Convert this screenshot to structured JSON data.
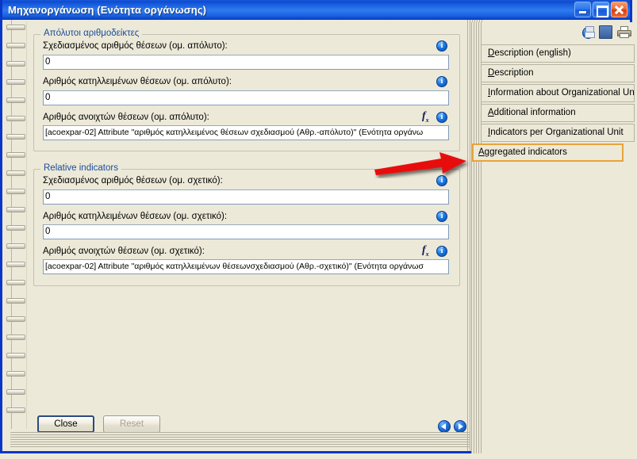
{
  "window": {
    "title": "Μηχανοργάνωση (Ενότητα οργάνωσης)",
    "minimize_label": "Minimize",
    "maximize_label": "Maximize",
    "close_label": "Close",
    "accent_titlebar": "#1b63e2",
    "accent_border": "#0a36c8",
    "background": "#ece9d8"
  },
  "groups": [
    {
      "title": "Απόλυτοι αριθμοδείκτες",
      "title_color": "#1b4b9b",
      "fields": [
        {
          "label": "Σχεδιασμένος αριθμός θέσεων (ομ. απόλυτο):",
          "value": "0",
          "has_fx": false,
          "info_icon": "info-icon"
        },
        {
          "label": "Αριθμός κατηλλειμένων θέσεων (ομ. απόλυτο):",
          "value": "0",
          "has_fx": false,
          "info_icon": "info-icon"
        },
        {
          "label": "Αριθμός ανοιχτών θέσεων (ομ. απόλυτο):",
          "value": "[acoexpar-02] Attribute \"αριθμός κατηλλειμένος θέσεων σχεδιασμού (Αθρ.-απόλυτο)\" (Ενότητα οργάνω",
          "has_fx": true,
          "fx_icon": "function-icon",
          "info_icon": "info-icon"
        }
      ]
    },
    {
      "title": "Relative indicators",
      "title_color": "#1b4b9b",
      "fields": [
        {
          "label": "Σχεδιασμένος αριθμός θέσεων (ομ. σχετικό):",
          "value": "0",
          "has_fx": false,
          "info_icon": "info-icon"
        },
        {
          "label": "Αριθμός κατηλλειμένων θέσεων (ομ. σχετικό):",
          "value": "0",
          "has_fx": false,
          "info_icon": "info-icon"
        },
        {
          "label": "Αριθμός ανοιχτών θέσεων (ομ. σχετικό):",
          "value": "[acoexpar-02] Attribute \"αριθμός κατηλλειμένων θέσεωνσχεδιασμού (Αθρ.-σχετικό)\" (Ενότητα οργάνωσ",
          "has_fx": true,
          "fx_icon": "function-icon",
          "info_icon": "info-icon"
        }
      ]
    }
  ],
  "footer": {
    "close_button": "Close",
    "reset_button": "Reset",
    "reset_disabled": true,
    "prev_label": "Previous",
    "next_label": "Next"
  },
  "tab_toolbar": {
    "info": "info-icon",
    "save": "save-icon",
    "print": "print-icon"
  },
  "tabs": [
    {
      "accel": "D",
      "rest": "escription (english)",
      "selected": false
    },
    {
      "accel": "D",
      "rest": "escription",
      "selected": false
    },
    {
      "accel": "I",
      "rest": "nformation about Organizational Unit",
      "selected": false
    },
    {
      "accel": "A",
      "rest": "dditional information",
      "selected": false
    },
    {
      "accel": "I",
      "rest": "ndicators per Organizational Unit",
      "selected": false
    },
    {
      "accel": "A",
      "rest": "ggregated indicators",
      "selected": true
    }
  ],
  "annotation": {
    "type": "red-arrow",
    "color": "#e81010",
    "points_to": "Aggregated indicators"
  }
}
